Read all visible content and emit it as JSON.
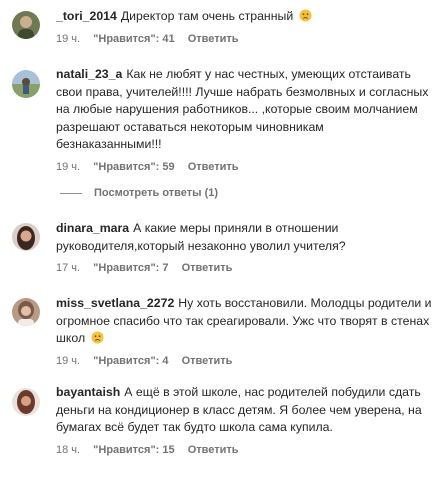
{
  "comments": [
    {
      "username": "_tori_2014",
      "text": "Директор там очень странный",
      "time": "19 ч.",
      "likes": "\"Нравится\": 41",
      "reply": "Ответить",
      "avatar_color": "#6f7a55",
      "emoji": "sad-face"
    },
    {
      "username": "natali_23_a",
      "text": "Как не любят у нас честных, умеющих отстаивать свои права, учителей!!!! Лучше набрать безмолвных и согласных на любые нарушения работников... ,которые своим молчанием разрешают оставаться некоторым чиновникам безнаказанными!!!",
      "time": "19 ч.",
      "likes": "\"Нравится\": 59",
      "reply": "Ответить",
      "avatar_color": "#8aa06a"
    },
    {
      "username": "dinara_mara",
      "text": "А какие меры приняли в отношении руководителя,который незаконно уволил учителя?",
      "time": "17 ч.",
      "likes": "\"Нравится\": 7",
      "reply": "Ответить",
      "avatar_color": "#5a3f33"
    },
    {
      "username": "miss_svetlana_2272",
      "text": "Ну хоть восстановили. Молодцы родители и огромное спасибо что так среагировали. Ужс что творят в стенах школ",
      "time": "19 ч.",
      "likes": "\"Нравится\": 4",
      "reply": "Ответить",
      "avatar_color": "#b99a86",
      "emoji": "sad-face"
    },
    {
      "username": "bayantaish",
      "text": "А ещё в этой школе, нас родителей побудили сдать деньги на кондиционер в класс детям. Я более чем уверена, на бумагах всё будет так будто школа сама купила.",
      "time": "18 ч.",
      "likes": "\"Нравится\": 15",
      "reply": "Ответить",
      "avatar_color": "#6b3a2c"
    }
  ],
  "view_replies": "Посмотреть ответы (1)"
}
